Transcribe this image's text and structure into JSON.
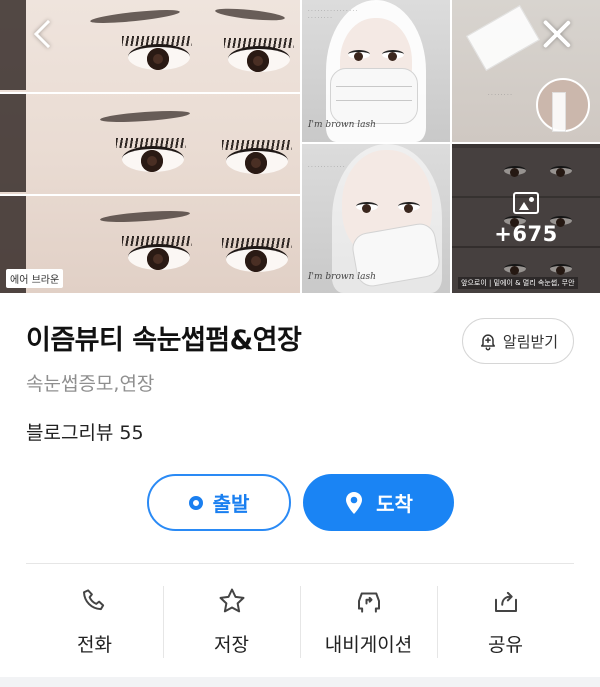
{
  "gallery": {
    "caption_tag": "에어 브라운",
    "watermark": "I'm brown lash",
    "more_count": "+675",
    "bottom_caption": "앞으로이 | 밑에이 & 멀리 속눈썹, 무안"
  },
  "place": {
    "title": "이즘뷰티 속눈썹펌&연장",
    "category": "속눈썹증모,연장",
    "review_label": "블로그리뷰",
    "review_count": "55",
    "notify_label": "알림받기"
  },
  "route": {
    "depart_label": "출발",
    "arrive_label": "도착"
  },
  "actions": {
    "call": "전화",
    "save": "저장",
    "navigation": "내비게이션",
    "share": "공유"
  },
  "colors": {
    "accent": "#1a84f4",
    "accent_text": "#1a7ff0",
    "muted": "#8f8f8f"
  },
  "icons": {
    "back": "chevron-left-icon",
    "close": "close-icon",
    "gallery": "image-icon",
    "bell": "bell-plus-icon",
    "depart": "ring-icon",
    "arrive": "map-pin-icon",
    "call": "phone-icon",
    "save": "star-icon",
    "navigation": "car-arrow-icon",
    "share": "share-icon"
  }
}
